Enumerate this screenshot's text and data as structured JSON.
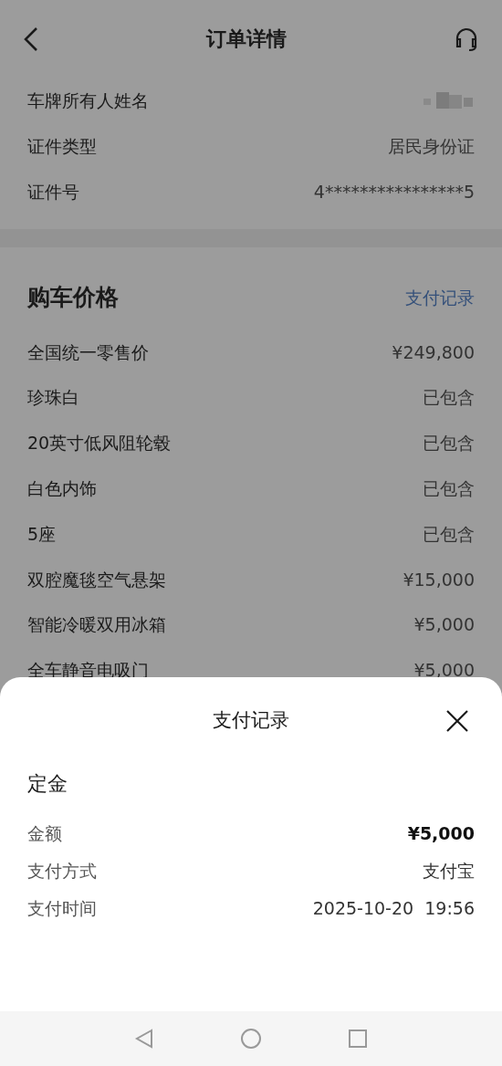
{
  "header": {
    "title": "订单详情"
  },
  "owner_info": [
    {
      "label": "车牌所有人姓名",
      "kind": "blurred"
    },
    {
      "label": "证件类型",
      "kind": "text",
      "value": "居民身份证"
    },
    {
      "label": "证件号",
      "kind": "text",
      "value": "4****************5"
    }
  ],
  "price_section": {
    "title": "购车价格",
    "link": "支付记录",
    "rows": [
      {
        "label": "全国统一零售价",
        "value": "¥249,800"
      },
      {
        "label": "珍珠白",
        "value": "已包含"
      },
      {
        "label": "20英寸低风阻轮毂",
        "value": "已包含"
      },
      {
        "label": "白色内饰",
        "value": "已包含"
      },
      {
        "label": "5座",
        "value": "已包含"
      },
      {
        "label": "双腔魔毯空气悬架",
        "value": "¥15,000"
      },
      {
        "label": "智能冷暖双用冰箱",
        "value": "¥5,000"
      },
      {
        "label": "全车静音电吸门",
        "value": "¥5,000"
      }
    ]
  },
  "sheet": {
    "title": "支付记录",
    "section_title": "定金",
    "rows": [
      {
        "label": "金额",
        "value": "¥5,000",
        "emphasized": true
      },
      {
        "label": "支付方式",
        "value": "支付宝",
        "emphasized": false
      },
      {
        "label": "支付时间",
        "value": "2025-10-20  19:56",
        "emphasized": false
      }
    ]
  }
}
